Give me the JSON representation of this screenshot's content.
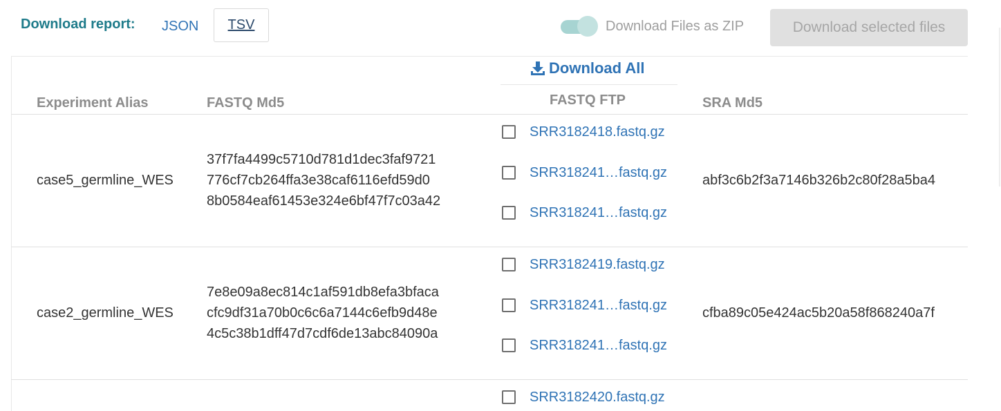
{
  "toolbar": {
    "report_label": "Download report:",
    "format_json": "JSON",
    "format_tsv": "TSV",
    "zip_toggle_label": "Download Files as ZIP",
    "download_selected_label": "Download selected files"
  },
  "table": {
    "download_all_label": "Download All",
    "headers": {
      "experiment_alias": "Experiment Alias",
      "fastq_md5": "FASTQ Md5",
      "fastq_ftp": "FASTQ FTP",
      "sra_md5": "SRA Md5"
    },
    "rows": [
      {
        "experiment_alias": "case5_germline_WES",
        "fastq_md5": [
          "37f7fa4499c5710d781d1dec3faf9721",
          "776cf7cb264ffa3e38caf6116efd59d0",
          "8b0584eaf61453e324e6bf47f7c03a42"
        ],
        "fastq_ftp": [
          "SRR3182418.fastq.gz",
          "SRR318241…fastq.gz",
          "SRR318241…fastq.gz"
        ],
        "sra_md5": "abf3c6b2f3a7146b326b2c80f28a5ba4"
      },
      {
        "experiment_alias": "case2_germline_WES",
        "fastq_md5": [
          "7e8e09a8ec814c1af591db8efa3bfaca",
          "cfc9df31a70b0c6c6a7144c6efb9d48e",
          "4c5c38b1dff47d7cdf6de13abc84090a"
        ],
        "fastq_ftp": [
          "SRR3182419.fastq.gz",
          "SRR318241…fastq.gz",
          "SRR318241…fastq.gz"
        ],
        "sra_md5": "cfba89c05e424ac5b20a58f868240a7f"
      },
      {
        "fastq_ftp": [
          "SRR3182420.fastq.gz"
        ]
      }
    ]
  },
  "colors": {
    "accent_teal": "#1e7b8a",
    "link_blue": "#2f73b5",
    "toggle_track": "#a7d4d2",
    "button_disabled_bg": "#e0e0e0"
  },
  "icons": {
    "download_all": "download-arrow-icon",
    "zip_toggle": "toggle-switch"
  }
}
